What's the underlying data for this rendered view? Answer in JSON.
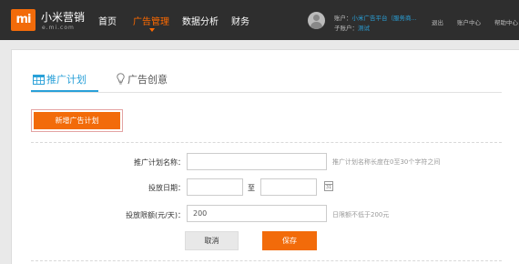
{
  "header": {
    "logo_text": "mi",
    "brand_name": "小米营销",
    "brand_sub": "e.mi.com",
    "nav": [
      "首页",
      "广告管理",
      "数据分析",
      "财务"
    ],
    "active_nav": "广告管理",
    "account_label": "账户：",
    "account_value": "小米广告平台（服务商...",
    "sub_account_label": "子账户：",
    "sub_account_value": "测试",
    "links": [
      "退出",
      "账户中心",
      "帮助中心"
    ]
  },
  "tabs": {
    "plan": "推广计划",
    "creative": "广告创意",
    "active": "推广计划"
  },
  "new_plan_button": "新增广告计划",
  "form": {
    "name_label": "推广计划名称：",
    "name_value": "",
    "name_hint": "推广计划名称长度在0至30个字符之间",
    "date_label": "投放日期：",
    "date_start": "",
    "date_to": "至",
    "date_end": "",
    "calendar_day": "31",
    "budget_label": "投放限额(元/天)：",
    "budget_value": "200",
    "budget_hint": "日限额不低于200元",
    "cancel_label": "取消",
    "save_label": "保存"
  },
  "colors": {
    "accent": "#f26b0a",
    "link_blue": "#29a0d8",
    "topbar_bg": "#2e2e2e"
  },
  "icons": {
    "plan_tab": "calendar-grid-icon",
    "creative_tab": "lightbulb-icon",
    "date_picker": "calendar-icon",
    "user": "avatar-icon"
  }
}
